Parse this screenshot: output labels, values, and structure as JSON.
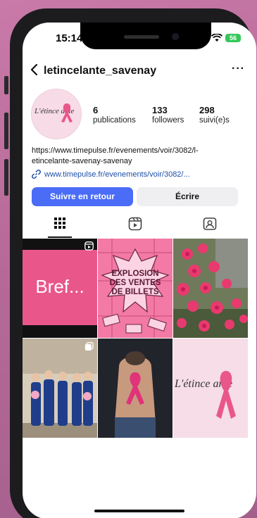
{
  "status_bar": {
    "time": "15:14",
    "battery": "56"
  },
  "header": {
    "username": "letincelante_savenay",
    "more_label": "···"
  },
  "avatar": {
    "logo_text": "L'étince ante"
  },
  "stats": [
    {
      "value": "6",
      "label": "publications"
    },
    {
      "value": "133",
      "label": "followers"
    },
    {
      "value": "298",
      "label": "suivi(e)s"
    }
  ],
  "bio": {
    "line1": "https://www.timepulse.fr/evenements/voir/3082/l-",
    "line2": "etincelante-savenay-savenay"
  },
  "link": {
    "text": "www.timepulse.fr/evenements/voir/3082/..."
  },
  "buttons": {
    "follow": "Suivre en retour",
    "write": "Écrire"
  },
  "posts": [
    {
      "kind": "text",
      "text": "Bref...",
      "badge": "reel-icon"
    },
    {
      "kind": "image",
      "headline": "EXPLOSION DES VENTES DE BILLETS"
    },
    {
      "kind": "image",
      "description": "pink flowers"
    },
    {
      "kind": "image",
      "description": "group photo",
      "badge": "carousel-icon"
    },
    {
      "kind": "image",
      "description": "pink ribbon on back"
    },
    {
      "kind": "image",
      "logo_text": "L'étince ante"
    }
  ],
  "colors": {
    "accent": "#4a6cf7",
    "brand_pink": "#e9568a",
    "link": "#1d4ea8"
  }
}
